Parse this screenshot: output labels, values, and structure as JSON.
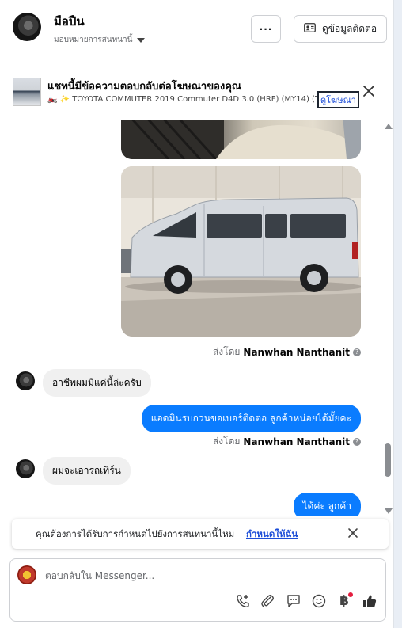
{
  "header": {
    "contact_name": "มือปืน",
    "assign_label": "มอบหมายการสนทนานี้",
    "more_label": "···",
    "contact_info_label": "ดูข้อมูลติดต่อ"
  },
  "ad": {
    "title": "แชทนี้มีข้อความตอบกลับต่อโฆษณาของคุณ",
    "line": "🏍️ ✨ TOYOTA COMMUTER 2019 Commuter D4D 3.0 (HRF) (MY14) (T...",
    "link": "ดูโฆษณา"
  },
  "messages": {
    "sent_by_prefix": "ส่งโดย",
    "sender": "Nanwhan Nanthanit",
    "info_glyph": "?",
    "in_1": "อาชีพผมมีแค่นี้ล่ะครับ",
    "out_1": "แอดมินรบกวนขอเบอร์ติดต่อ ลูกค้าหน่อยได้มั้ยคะ",
    "in_2": "ผมจะเอารถเทิร์น",
    "out_2": "ได้ค่ะ ลูกค้า"
  },
  "notice": {
    "text": "คุณต้องการได้รับการกำหนดไปยังการสนทนานี้ไหม",
    "link": "กำหนดให้ฉัน"
  },
  "composer": {
    "placeholder": "ตอบกลับใน Messenger...",
    "currency_glyph": "฿"
  },
  "icons": [
    "close-icon",
    "contact-card-icon",
    "phone-add-icon",
    "paperclip-icon",
    "chat-bubble-icon",
    "emoji-icon",
    "baht-icon",
    "thumbs-up-icon",
    "info-icon",
    "chevron-down-icon"
  ],
  "colors": {
    "accent": "#0a7cff",
    "link": "#1d4ed8",
    "incoming_bubble": "#f0f0f0",
    "badge": "#e41e3f"
  }
}
